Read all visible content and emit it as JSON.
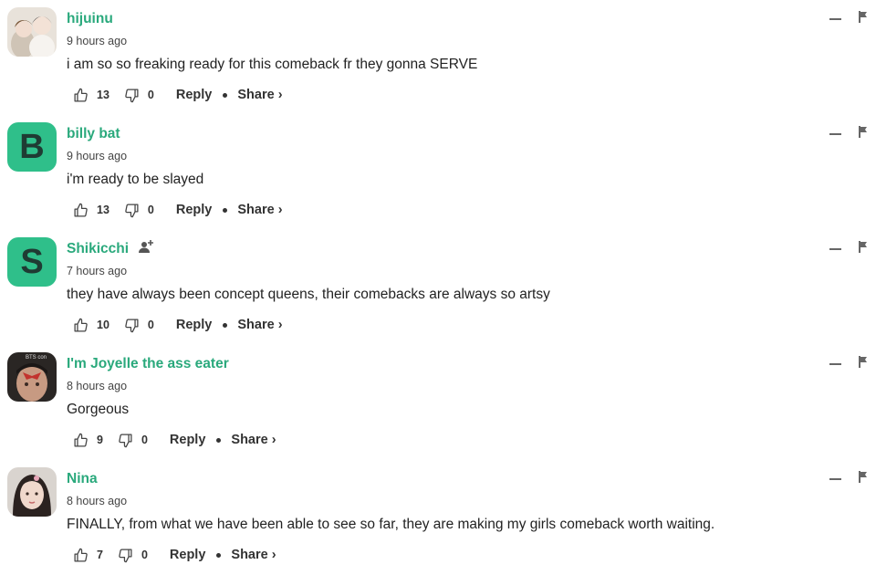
{
  "comments": [
    {
      "author": "hijuinu",
      "avatar": {
        "type": "image",
        "description": "anime-avatar"
      },
      "time": "9 hours ago",
      "text": "i am so so freaking ready for this comeback fr they gonna SERVE",
      "likes": "13",
      "dislikes": "0",
      "reply_label": "Reply",
      "share_label": "Share ›"
    },
    {
      "author": "billy bat",
      "avatar": {
        "type": "letter",
        "letter": "B"
      },
      "time": "9 hours ago",
      "text": "i'm ready to be slayed",
      "likes": "13",
      "dislikes": "0",
      "reply_label": "Reply",
      "share_label": "Share ›"
    },
    {
      "author": "Shikicchi",
      "avatar": {
        "type": "letter",
        "letter": "S"
      },
      "follow_icon": "add-follower-icon",
      "time": "7 hours ago",
      "text": "they have always been concept queens, their comebacks are always so artsy",
      "likes": "10",
      "dislikes": "0",
      "reply_label": "Reply",
      "share_label": "Share ›"
    },
    {
      "author": "I'm Joyelle the ass eater",
      "avatar": {
        "type": "image",
        "description": "photo-avatar",
        "overlay_text": "BTS con"
      },
      "time": "8 hours ago",
      "text": "Gorgeous",
      "likes": "9",
      "dislikes": "0",
      "reply_label": "Reply",
      "share_label": "Share ›"
    },
    {
      "author": "Nina",
      "avatar": {
        "type": "image",
        "description": "photo-avatar"
      },
      "time": "8 hours ago",
      "text": "FINALLY, from what we have been able to see so far, they are making my girls comeback worth waiting.",
      "likes": "7",
      "dislikes": "0",
      "reply_label": "Reply",
      "share_label": "Share ›"
    }
  ],
  "icons": {
    "like": "thumbs-up-icon",
    "dislike": "thumbs-down-icon",
    "collapse": "minus-icon",
    "report": "flag-icon"
  },
  "colors": {
    "author": "#2aa97c",
    "letter_avatar_bg": "#2fbf8a",
    "text": "#222222",
    "muted": "#666666"
  }
}
